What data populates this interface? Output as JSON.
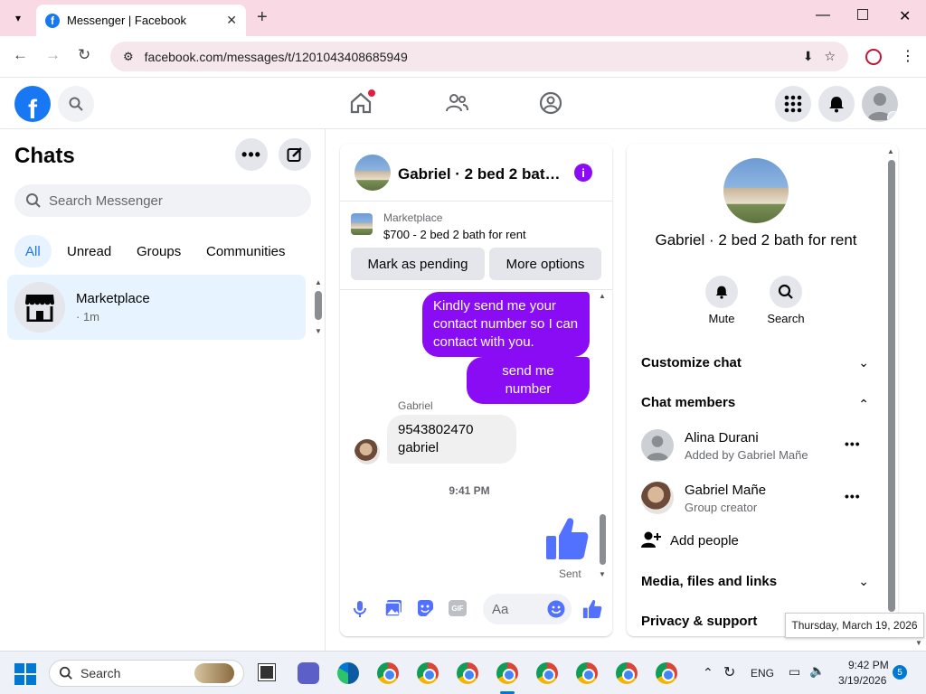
{
  "browser": {
    "tab_title": "Messenger | Facebook",
    "url": "facebook.com/messages/t/1201043408685949"
  },
  "sidebar": {
    "title": "Chats",
    "search_placeholder": "Search Messenger",
    "filters": [
      {
        "label": "All"
      },
      {
        "label": "Unread"
      },
      {
        "label": "Groups"
      },
      {
        "label": "Communities"
      }
    ],
    "chat": {
      "name": "Marketplace",
      "meta": "· 1m"
    }
  },
  "conversation": {
    "title": "Gabriel · 2 bed 2 bat…",
    "marketplace_label": "Marketplace",
    "listing": "$700 - 2 bed 2 bath for rent",
    "mark_pending": "Mark as pending",
    "more_options": "More options",
    "messages": {
      "out1": "Kindly send me your contact number so I can contact with you.",
      "out2": "send me number",
      "sender": "Gabriel",
      "in1_line1": "9543802470",
      "in1_line2": "gabriel",
      "time": "9:41 PM",
      "status": "Sent"
    },
    "composer_placeholder": "Aa",
    "gif_label": "GIF"
  },
  "details": {
    "title": "Gabriel · 2 bed 2 bath for rent",
    "mute": "Mute",
    "search": "Search",
    "customize": "Customize chat",
    "members_header": "Chat members",
    "members": [
      {
        "name": "Alina Durani",
        "sub": "Added by Gabriel Mañe"
      },
      {
        "name": "Gabriel Mañe",
        "sub": "Group creator"
      }
    ],
    "add_people": "Add people",
    "media": "Media, files and links",
    "privacy": "Privacy & support"
  },
  "tooltip": "Thursday, March 19, 2026",
  "taskbar": {
    "search": "Search",
    "lang": "ENG",
    "time": "9:42 PM",
    "date": "3/19/2026",
    "badge": "5"
  },
  "colors": {
    "accent": "#1877f2",
    "bubble": "#8a0cf5",
    "active_bg": "#e7f3ff"
  }
}
